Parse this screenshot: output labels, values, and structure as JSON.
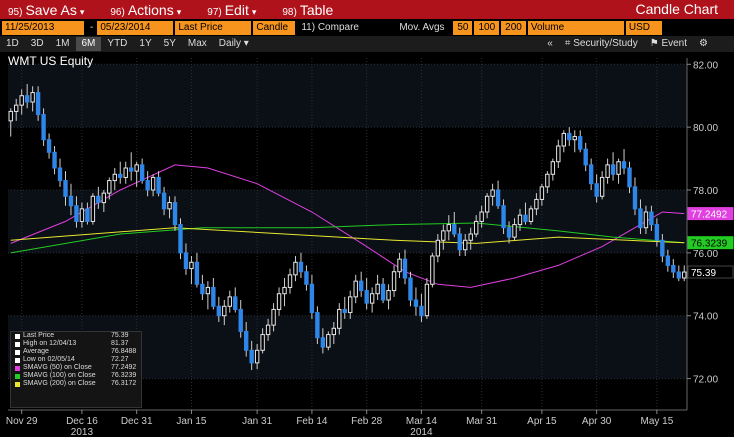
{
  "menubar": {
    "items": [
      {
        "num": "95)",
        "label": "Save As"
      },
      {
        "num": "96)",
        "label": "Actions"
      },
      {
        "num": "97)",
        "label": "Edit"
      },
      {
        "num": "98)",
        "label": "Table"
      }
    ],
    "title": "Candle Chart"
  },
  "toolbar": {
    "ticker": "WMT US Equity",
    "start_date": "11/25/2013",
    "end_date": "05/23/2014",
    "price_field": "Last Price",
    "chart_style": "Candle",
    "compare": "11) Compare",
    "mov_avgs": "Mov. Avgs",
    "ma1": "50",
    "ma2": "100",
    "ma3": "200",
    "volume": "Volume",
    "currency": "USD"
  },
  "rangebar": {
    "periods": [
      "1D",
      "3D",
      "1M",
      "6M",
      "YTD",
      "1Y",
      "5Y",
      "Max"
    ],
    "active": "6M",
    "frequency": "Daily",
    "security_study": "Security/Study",
    "event": "Event"
  },
  "legend": {
    "rows": [
      {
        "label": "Last Price",
        "value": "75.39",
        "color": "#ffffff"
      },
      {
        "label": "High on 12/04/13",
        "value": "81.37",
        "color": "#ffffff"
      },
      {
        "label": "Average",
        "value": "76.8488",
        "color": "#ffffff"
      },
      {
        "label": "Low on 02/05/14",
        "value": "72.27",
        "color": "#ffffff"
      },
      {
        "label": "SMAVG (50) on Close",
        "value": "77.2492",
        "color": "#e040e0"
      },
      {
        "label": "SMAVG (100) on Close",
        "value": "76.3239",
        "color": "#22cc22"
      },
      {
        "label": "SMAVG (200) on Close",
        "value": "76.3172",
        "color": "#e8e830"
      }
    ]
  },
  "chart_data": {
    "type": "candlestick",
    "ylim": [
      71.0,
      82.2
    ],
    "yticks": [
      72.0,
      74.0,
      76.0,
      78.0,
      80.0,
      82.0
    ],
    "ytick_labels": [
      "72.00",
      "74.00",
      "76.00",
      "78.00",
      "80.00",
      "82.00"
    ],
    "xticks": [
      {
        "label": "Nov 29",
        "index": 2
      },
      {
        "label": "Dec 16",
        "index": 13
      },
      {
        "label": "Dec 31",
        "index": 23
      },
      {
        "label": "Jan 15",
        "index": 33
      },
      {
        "label": "Jan 31",
        "index": 45
      },
      {
        "label": "Feb 14",
        "index": 55
      },
      {
        "label": "Feb 28",
        "index": 65
      },
      {
        "label": "Mar 14",
        "index": 75
      },
      {
        "label": "Mar 31",
        "index": 86
      },
      {
        "label": "Apr 15",
        "index": 97
      },
      {
        "label": "Apr 30",
        "index": 107
      },
      {
        "label": "May 15",
        "index": 118
      }
    ],
    "year_labels": [
      {
        "label": "2013",
        "index": 13
      },
      {
        "label": "2014",
        "index": 75
      }
    ],
    "badges": [
      {
        "value": "77.2492",
        "bg": "#e040e0",
        "fg": "#ffffff"
      },
      {
        "value": "76.3239",
        "bg": "#22cc22",
        "fg": "#000000"
      },
      {
        "value": "75.39",
        "bg": "#000000",
        "fg": "#ffffff"
      }
    ],
    "n": 124,
    "candles": [
      [
        80.2,
        80.6,
        79.7,
        80.5
      ],
      [
        80.5,
        80.9,
        80.2,
        80.7
      ],
      [
        80.7,
        81.2,
        80.4,
        81.0
      ],
      [
        81.0,
        81.37,
        80.6,
        80.8
      ],
      [
        80.8,
        81.3,
        80.5,
        81.1
      ],
      [
        81.1,
        81.3,
        80.2,
        80.4
      ],
      [
        80.4,
        80.6,
        79.4,
        79.6
      ],
      [
        79.6,
        79.8,
        79.0,
        79.2
      ],
      [
        79.2,
        79.4,
        78.5,
        78.7
      ],
      [
        78.7,
        79.0,
        78.1,
        78.3
      ],
      [
        78.3,
        78.6,
        77.5,
        77.8
      ],
      [
        77.8,
        78.2,
        77.2,
        77.5
      ],
      [
        77.5,
        77.8,
        76.8,
        77.0
      ],
      [
        77.0,
        77.6,
        76.8,
        77.4
      ],
      [
        77.4,
        77.6,
        76.9,
        77.0
      ],
      [
        77.0,
        77.9,
        76.9,
        77.8
      ],
      [
        77.8,
        78.1,
        77.4,
        77.6
      ],
      [
        77.6,
        78.0,
        77.3,
        77.9
      ],
      [
        77.9,
        78.4,
        77.7,
        78.3
      ],
      [
        78.3,
        78.7,
        78.0,
        78.5
      ],
      [
        78.5,
        78.9,
        78.2,
        78.4
      ],
      [
        78.4,
        78.9,
        78.2,
        78.7
      ],
      [
        78.7,
        79.2,
        78.3,
        78.6
      ],
      [
        78.6,
        78.9,
        78.1,
        78.8
      ],
      [
        78.8,
        79.0,
        78.2,
        78.3
      ],
      [
        78.3,
        78.6,
        77.8,
        78.0
      ],
      [
        78.0,
        78.5,
        77.8,
        78.4
      ],
      [
        78.4,
        78.6,
        77.8,
        77.9
      ],
      [
        77.9,
        78.1,
        77.2,
        77.4
      ],
      [
        77.4,
        77.8,
        77.1,
        77.6
      ],
      [
        77.6,
        77.8,
        76.7,
        76.9
      ],
      [
        76.9,
        77.1,
        75.8,
        76.0
      ],
      [
        76.0,
        76.3,
        75.3,
        75.5
      ],
      [
        75.5,
        75.9,
        75.0,
        75.7
      ],
      [
        75.7,
        76.0,
        74.9,
        75.0
      ],
      [
        75.0,
        75.3,
        74.5,
        74.7
      ],
      [
        74.7,
        75.1,
        74.2,
        74.9
      ],
      [
        74.9,
        75.2,
        74.2,
        74.3
      ],
      [
        74.3,
        74.6,
        73.8,
        74.0
      ],
      [
        74.0,
        74.5,
        73.7,
        74.3
      ],
      [
        74.3,
        74.8,
        74.1,
        74.6
      ],
      [
        74.6,
        74.9,
        74.1,
        74.2
      ],
      [
        74.2,
        74.5,
        73.3,
        73.5
      ],
      [
        73.5,
        73.8,
        72.7,
        72.9
      ],
      [
        72.9,
        73.2,
        72.27,
        72.5
      ],
      [
        72.5,
        73.1,
        72.3,
        72.9
      ],
      [
        72.9,
        73.6,
        72.8,
        73.4
      ],
      [
        73.4,
        73.9,
        73.2,
        73.7
      ],
      [
        73.7,
        74.4,
        73.5,
        74.2
      ],
      [
        74.2,
        74.9,
        74.0,
        74.7
      ],
      [
        74.7,
        75.2,
        74.3,
        74.9
      ],
      [
        74.9,
        75.5,
        74.7,
        75.3
      ],
      [
        75.3,
        75.9,
        75.1,
        75.7
      ],
      [
        75.7,
        76.0,
        75.2,
        75.4
      ],
      [
        75.4,
        75.6,
        74.8,
        75.0
      ],
      [
        75.0,
        75.3,
        73.9,
        74.1
      ],
      [
        74.1,
        74.3,
        73.1,
        73.3
      ],
      [
        73.3,
        73.6,
        72.8,
        73.0
      ],
      [
        73.0,
        73.5,
        72.9,
        73.4
      ],
      [
        73.4,
        73.8,
        73.1,
        73.6
      ],
      [
        73.6,
        74.4,
        73.4,
        74.2
      ],
      [
        74.2,
        74.6,
        73.9,
        74.1
      ],
      [
        74.1,
        74.8,
        73.9,
        74.6
      ],
      [
        74.6,
        75.3,
        74.4,
        75.1
      ],
      [
        75.1,
        75.4,
        74.6,
        74.8
      ],
      [
        74.8,
        75.2,
        74.2,
        74.4
      ],
      [
        74.4,
        74.9,
        74.1,
        74.7
      ],
      [
        74.7,
        75.3,
        74.5,
        75.0
      ],
      [
        75.0,
        75.2,
        74.4,
        74.5
      ],
      [
        74.5,
        75.0,
        74.2,
        74.8
      ],
      [
        74.8,
        75.6,
        74.6,
        75.4
      ],
      [
        75.4,
        76.0,
        75.2,
        75.8
      ],
      [
        75.8,
        76.1,
        75.0,
        75.2
      ],
      [
        75.2,
        75.4,
        74.3,
        74.5
      ],
      [
        74.5,
        74.9,
        74.0,
        74.3
      ],
      [
        74.3,
        74.7,
        73.8,
        74.0
      ],
      [
        74.0,
        75.2,
        73.9,
        75.0
      ],
      [
        75.0,
        76.0,
        74.9,
        75.9
      ],
      [
        75.9,
        76.6,
        75.7,
        76.4
      ],
      [
        76.4,
        76.9,
        76.1,
        76.7
      ],
      [
        76.7,
        77.2,
        76.4,
        76.9
      ],
      [
        76.9,
        77.3,
        76.5,
        76.6
      ],
      [
        76.6,
        76.8,
        75.9,
        76.1
      ],
      [
        76.1,
        76.6,
        75.9,
        76.4
      ],
      [
        76.4,
        76.8,
        76.1,
        76.6
      ],
      [
        76.6,
        77.2,
        76.5,
        77.0
      ],
      [
        77.0,
        77.5,
        76.8,
        77.3
      ],
      [
        77.3,
        77.9,
        77.1,
        77.8
      ],
      [
        77.8,
        78.2,
        77.5,
        78.0
      ],
      [
        78.0,
        78.3,
        77.4,
        77.5
      ],
      [
        77.5,
        77.7,
        76.6,
        76.8
      ],
      [
        76.8,
        77.0,
        76.3,
        76.5
      ],
      [
        76.5,
        77.1,
        76.4,
        76.9
      ],
      [
        76.9,
        77.4,
        76.7,
        77.2
      ],
      [
        77.2,
        77.6,
        76.9,
        77.0
      ],
      [
        77.0,
        77.5,
        76.9,
        77.4
      ],
      [
        77.4,
        77.9,
        77.2,
        77.7
      ],
      [
        77.7,
        78.2,
        77.5,
        78.1
      ],
      [
        78.1,
        78.6,
        77.9,
        78.5
      ],
      [
        78.5,
        79.0,
        78.3,
        78.9
      ],
      [
        78.9,
        79.6,
        78.7,
        79.4
      ],
      [
        79.4,
        79.9,
        79.2,
        79.8
      ],
      [
        79.8,
        80.0,
        79.4,
        79.6
      ],
      [
        79.6,
        79.9,
        79.2,
        79.7
      ],
      [
        79.7,
        79.9,
        79.2,
        79.3
      ],
      [
        79.3,
        79.5,
        78.6,
        78.8
      ],
      [
        78.8,
        79.0,
        78.0,
        78.2
      ],
      [
        78.2,
        78.5,
        77.6,
        77.8
      ],
      [
        77.8,
        78.6,
        77.7,
        78.4
      ],
      [
        78.4,
        79.0,
        78.2,
        78.8
      ],
      [
        78.8,
        79.2,
        78.3,
        78.5
      ],
      [
        78.5,
        79.0,
        78.2,
        78.9
      ],
      [
        78.9,
        79.3,
        78.5,
        78.7
      ],
      [
        78.7,
        78.9,
        77.9,
        78.1
      ],
      [
        78.1,
        78.4,
        77.2,
        77.4
      ],
      [
        77.4,
        77.7,
        76.6,
        76.8
      ],
      [
        76.8,
        77.5,
        76.6,
        77.3
      ],
      [
        77.3,
        77.5,
        76.7,
        76.9
      ],
      [
        76.9,
        77.1,
        76.2,
        76.4
      ],
      [
        76.4,
        76.6,
        75.7,
        75.9
      ],
      [
        75.9,
        76.1,
        75.4,
        75.6
      ],
      [
        75.6,
        75.8,
        75.2,
        75.39
      ],
      [
        75.39,
        75.6,
        75.1,
        75.2
      ],
      [
        75.2,
        75.6,
        75.1,
        75.39
      ]
    ],
    "series": [
      {
        "name": "SMAVG (50) on Close",
        "color": "#e040e0",
        "points": [
          [
            0,
            76.3
          ],
          [
            10,
            77.0
          ],
          [
            20,
            78.0
          ],
          [
            30,
            78.8
          ],
          [
            36,
            78.7
          ],
          [
            45,
            78.2
          ],
          [
            55,
            77.3
          ],
          [
            65,
            76.2
          ],
          [
            72,
            75.4
          ],
          [
            78,
            75.0
          ],
          [
            84,
            74.9
          ],
          [
            92,
            75.2
          ],
          [
            100,
            75.6
          ],
          [
            108,
            76.2
          ],
          [
            114,
            76.8
          ],
          [
            119,
            77.3
          ],
          [
            123,
            77.25
          ]
        ]
      },
      {
        "name": "SMAVG (100) on Close",
        "color": "#22cc22",
        "points": [
          [
            0,
            76.0
          ],
          [
            20,
            76.6
          ],
          [
            35,
            76.8
          ],
          [
            55,
            76.8
          ],
          [
            70,
            76.9
          ],
          [
            85,
            76.95
          ],
          [
            100,
            76.7
          ],
          [
            110,
            76.5
          ],
          [
            123,
            76.32
          ]
        ]
      },
      {
        "name": "SMAVG (200) on Close",
        "color": "#e8e830",
        "points": [
          [
            0,
            76.4
          ],
          [
            30,
            76.8
          ],
          [
            50,
            76.6
          ],
          [
            70,
            76.4
          ],
          [
            85,
            76.3
          ],
          [
            100,
            76.5
          ],
          [
            123,
            76.32
          ]
        ]
      }
    ]
  }
}
